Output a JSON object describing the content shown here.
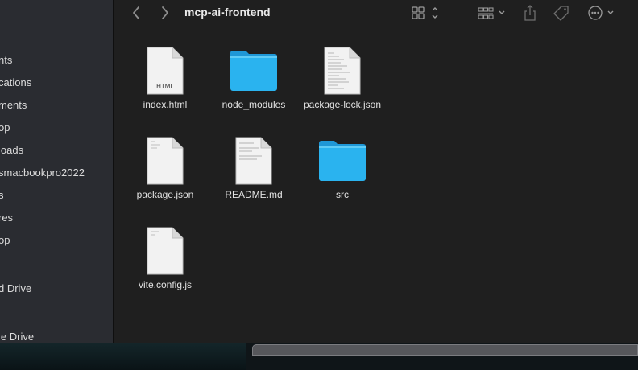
{
  "window": {
    "title": "mcp-ai-frontend"
  },
  "sidebar": {
    "items": [
      {
        "label": "nts"
      },
      {
        "label": "cations"
      },
      {
        "label": "ments"
      },
      {
        "label": "op"
      },
      {
        "label": "loads"
      },
      {
        "label": "smacbookpro2022"
      },
      {
        "label": "s"
      },
      {
        "label": "res"
      },
      {
        "label": "op"
      },
      {
        "label": "d Drive"
      },
      {
        "label": "le Drive"
      }
    ]
  },
  "toolbar": {
    "back_icon": "chevron-left-icon",
    "forward_icon": "chevron-right-icon",
    "view_icon": "grid-view-icon",
    "group_icon": "group-by-icon",
    "share_icon": "share-icon",
    "tag_icon": "tag-icon",
    "more_icon": "more-actions-icon"
  },
  "files": [
    {
      "name": "index.html",
      "type": "html",
      "badge": "HTML"
    },
    {
      "name": "node_modules",
      "type": "folder"
    },
    {
      "name": "package-lock.json",
      "type": "doc"
    },
    {
      "name": "package.json",
      "type": "doc"
    },
    {
      "name": "README.md",
      "type": "doc"
    },
    {
      "name": "src",
      "type": "folder"
    },
    {
      "name": "vite.config.js",
      "type": "doc"
    }
  ],
  "colors": {
    "folder": "#2ab3ef",
    "folder_tab": "#1f97d6",
    "background": "#1f1f1f",
    "sidebar": "#2a2c31"
  }
}
